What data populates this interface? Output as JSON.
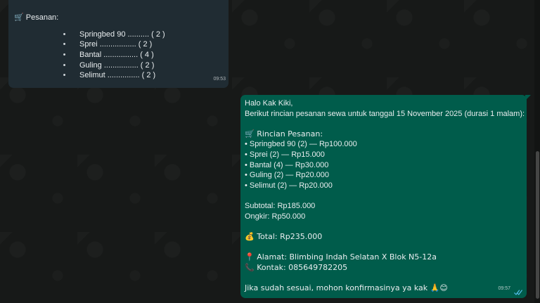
{
  "incoming_message": {
    "partial_top": "…",
    "title": "🛒 Pesanan:",
    "items": [
      {
        "bullet": "•",
        "text": "Springbed 90 .......... ( 2 )"
      },
      {
        "bullet": "•",
        "text": "Sprei ................. ( 2 )"
      },
      {
        "bullet": "•",
        "text": "Bantal ................ ( 4 )"
      },
      {
        "bullet": "•",
        "text": "Guling ................ ( 2 )"
      },
      {
        "bullet": "•",
        "text": "Selimut ............... ( 2 )"
      }
    ],
    "time": "09:53"
  },
  "outgoing_message": {
    "lines": [
      "Halo Kak Kiki,",
      "Berikut rincian pesanan sewa untuk tanggal 15 November 2025 (durasi 1 malam):",
      "",
      "🛒 Rincian Pesanan:",
      "• Springbed 90 (2) — Rp100.000",
      "• Sprei (2) — Rp15.000",
      "• Bantal (4) — Rp30.000",
      "• Guling (2) — Rp20.000",
      "• Selimut (2) — Rp20.000",
      "",
      "Subtotal: Rp185.000",
      "Ongkir: Rp50.000",
      "",
      "💰 Total: Rp235.000",
      "",
      "📍 Alamat: Blimbing Indah Selatan X Blok N5-12a",
      "📞 Kontak: 085649782205",
      "",
      "Jika sudah sesuai, mohon konfirmasinya ya kak 🙏😊"
    ],
    "time": "09:57",
    "status": "delivered-read",
    "status_icon": "double-check-icon"
  },
  "colors": {
    "background": "#171918",
    "incoming_bubble": "#202c33",
    "outgoing_bubble": "#005c4b",
    "text": "#e9edef"
  }
}
